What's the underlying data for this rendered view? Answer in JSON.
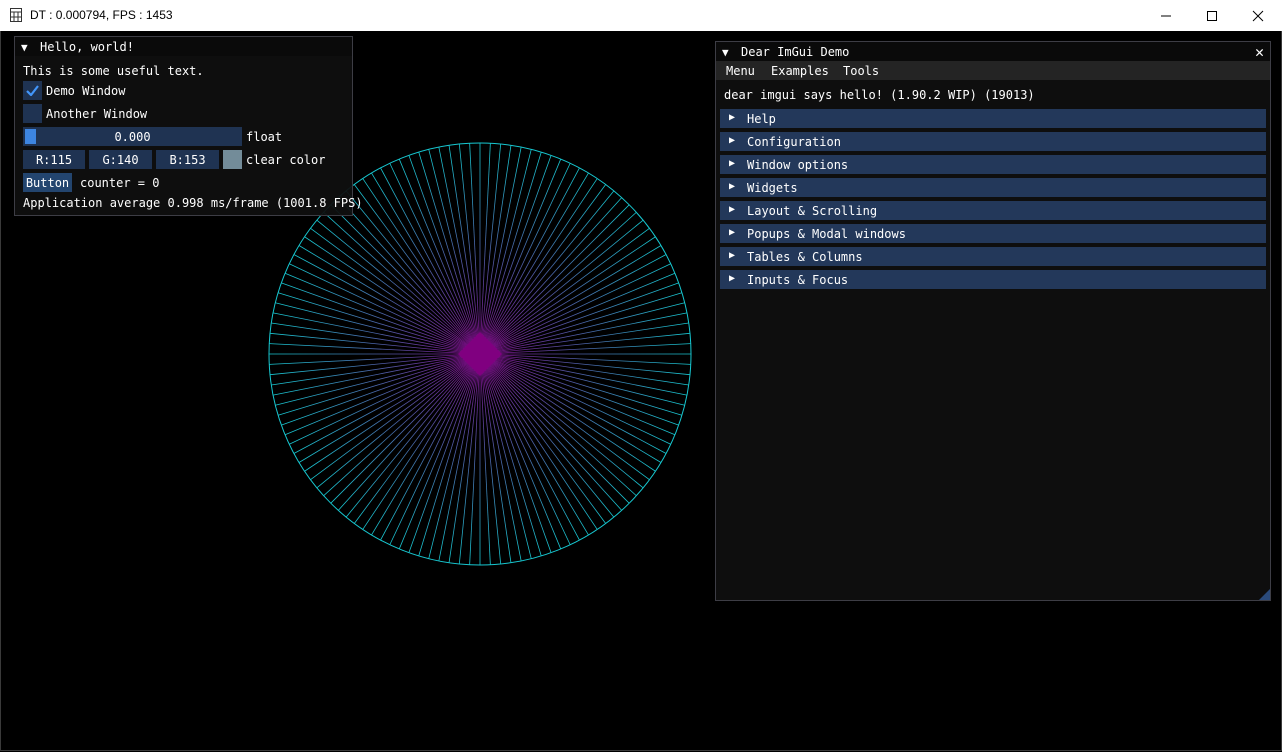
{
  "os_window": {
    "title": "DT : 0.000794, FPS : 1453"
  },
  "hello_window": {
    "title": "Hello, world!",
    "text": "This is some useful text.",
    "demo_checkbox": {
      "label": "Demo Window",
      "checked": true
    },
    "another_checkbox": {
      "label": "Another Window",
      "checked": false
    },
    "float_slider": {
      "value": "0.000",
      "label": "float"
    },
    "color": {
      "r": "R:115",
      "g": "G:140",
      "b": "B:153",
      "label": "clear color",
      "swatch": "#738c99"
    },
    "button_label": "Button",
    "counter_text": "counter = 0",
    "fps_text": "Application average 0.998 ms/frame (1001.8 FPS)"
  },
  "demo_window": {
    "title": "Dear ImGui Demo",
    "menu": [
      "Menu",
      "Examples",
      "Tools"
    ],
    "hello_text": "dear imgui says hello! (1.90.2 WIP) (19013)",
    "headers": [
      "Help",
      "Configuration",
      "Window options",
      "Widgets",
      "Layout & Scrolling",
      "Popups & Modal windows",
      "Tables & Columns",
      "Inputs & Focus"
    ]
  },
  "circle": {
    "line_color": "#17c7d0",
    "center_color": "#800080"
  }
}
